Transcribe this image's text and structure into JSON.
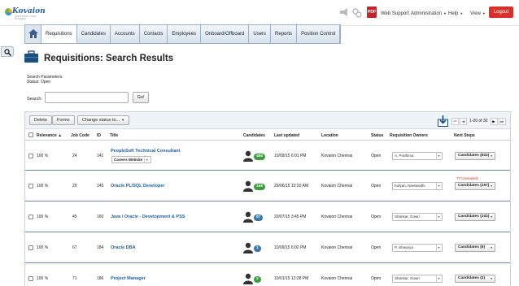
{
  "brand": {
    "name": "Kovaion",
    "tagline": "INNOVATING YOUR BUSINESS"
  },
  "topbar": {
    "icons": [
      "megaphone-icon",
      "connect-icon",
      "pdf-icon"
    ],
    "links": {
      "web_support": "Web Support",
      "administration": "Administration",
      "help": "Help",
      "view": "View"
    },
    "logout": "Logout"
  },
  "nav": {
    "tabs": [
      "Requisitions",
      "Candidates",
      "Accounts",
      "Contacts",
      "Employees",
      "Onboard/Offboard",
      "Users",
      "Reports",
      "Position Control"
    ],
    "active": "Requisitions"
  },
  "page": {
    "title": "Requisitions: Search Results"
  },
  "search_params": {
    "heading": "Search Parameters:",
    "status": "Status:  Open"
  },
  "search": {
    "label": "Search:",
    "value": "",
    "go": "Go!"
  },
  "toolbar": {
    "delete": "Delete",
    "forms": "Forms",
    "change_status": "Change status to..."
  },
  "pager": {
    "info": "1-20 of 32"
  },
  "columns": {
    "relevance": "Relevance",
    "job_code": "Job Code",
    "id": "ID",
    "title": "Title",
    "candidates": "Candidates",
    "last_updated": "Last updated",
    "location": "Location",
    "status": "Status",
    "owners": "Requisition Owners",
    "next_steps": "Next Steps"
  },
  "colors": {
    "badge_green": "#3e9b3e",
    "badge_blue": "#3a78a8",
    "link": "#1f5fa8",
    "logout": "#d9302b"
  },
  "rows": [
    {
      "relevance": "100 %",
      "job_code": "24",
      "id": "141",
      "title": "PeopleSoft Technical Consultant",
      "sub_select": "Careers Website",
      "candidates": "456",
      "badge_color": "#3e9b3e",
      "updated": "10/09/15 6:01 PM",
      "location": "Kovaion Chennai",
      "status": "Open",
      "owner": "A, Prathima",
      "unviewed": "",
      "next": "Candidates (602)"
    },
    {
      "relevance": "100 %",
      "job_code": "29",
      "id": "145",
      "title": "Oracle PL/SQL Developer",
      "sub_select": "",
      "candidates": "146",
      "badge_color": "#3e9b3e",
      "updated": "29/06/15 10:20 AM",
      "location": "Kovaion Chennai",
      "status": "Open",
      "owner": "Kalyan, Neelavathi",
      "unviewed": "77 Unviewed",
      "next": "Candidates (157)"
    },
    {
      "relevance": "100 %",
      "job_code": "45",
      "id": "160",
      "title": "Java / Oracle - Development & PSS",
      "sub_select": "",
      "candidates": "97",
      "badge_color": "#3a78a8",
      "updated": "20/07/15 3:45 PM",
      "location": "Kovaion Chennai",
      "status": "Open",
      "owner": "Shankar, Gowri",
      "unviewed": "",
      "next": "Candidates (102)"
    },
    {
      "relevance": "100 %",
      "job_code": "67",
      "id": "184",
      "title": "Oracle DBA",
      "sub_select": "",
      "candidates": "1",
      "badge_color": "#3a78a8",
      "updated": "10/09/15 6:02 PM",
      "location": "Kovaion Chennai",
      "status": "Open",
      "owner": "P, Ishwarya",
      "unviewed": "",
      "next": "Candidates (9)"
    },
    {
      "relevance": "100 %",
      "job_code": "71",
      "id": "186",
      "title": "Project Manager",
      "sub_select": "",
      "candidates": "2",
      "badge_color": "#3e9b3e",
      "updated": "10/01/15 12:28 PM",
      "location": "Kovaion Chennai",
      "status": "Open",
      "owner": "Shankar, Gowri",
      "unviewed": "",
      "next": "Candidates (2)"
    }
  ]
}
